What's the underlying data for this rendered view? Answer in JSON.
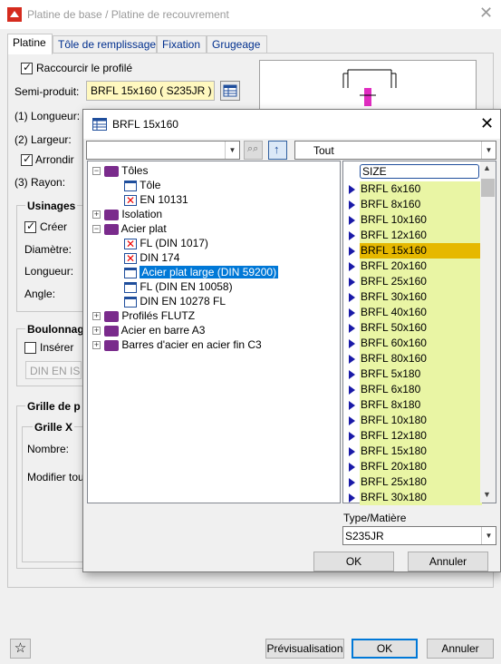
{
  "window": {
    "title": "Platine de base / Platine de recouvrement"
  },
  "tabs": [
    "Platine",
    "Tôle de remplissage",
    "Fixation",
    "Grugeage"
  ],
  "platine": {
    "raccourcir_label": "Raccourcir le profilé",
    "semi_produit_label": "Semi-produit:",
    "semi_produit_value": "BRFL 15x160  ( S235JR )",
    "longueur_label": "(1) Longueur:",
    "largeur_label": "(2) Largeur:",
    "arrondir_label": "Arrondir",
    "rayon_label": "(3) Rayon:",
    "usinages_title": "Usinages",
    "creer_label": "Créer",
    "diametre_label": "Diamètre:",
    "longueur2_label": "Longueur:",
    "angle_label": "Angle:",
    "boulonnage_title": "Boulonnag",
    "inserer_label": "Insérer",
    "din_button": "DIN EN ISO",
    "grille_title": "Grille de p",
    "grille_x_title": "Grille X",
    "nombre_label": "Nombre:",
    "modifier_label": "Modifier tou"
  },
  "footer": {
    "preview": "Prévisualisation",
    "ok": "OK",
    "cancel": "Annuler"
  },
  "dialog": {
    "title": "BRFL 15x160",
    "filter_value": "Tout",
    "tree": [
      {
        "label": "Tôles"
      },
      {
        "label": "Tôle"
      },
      {
        "label": "EN 10131"
      },
      {
        "label": "Isolation"
      },
      {
        "label": "Acier plat"
      },
      {
        "label": "FL (DIN 1017)"
      },
      {
        "label": "DIN 174"
      },
      {
        "label": "Acier plat large (DIN 59200)"
      },
      {
        "label": "FL (DIN EN 10058)"
      },
      {
        "label": "DIN EN 10278 FL"
      },
      {
        "label": "Profilés FLUTZ"
      },
      {
        "label": "Acier en barre A3"
      },
      {
        "label": "Barres d'acier en acier fin C3"
      }
    ],
    "list_header": "SIZE",
    "list": [
      "BRFL 6x160",
      "BRFL 8x160",
      "BRFL 10x160",
      "BRFL 12x160",
      "BRFL 15x160",
      "BRFL 20x160",
      "BRFL 25x160",
      "BRFL 30x160",
      "BRFL 40x160",
      "BRFL 50x160",
      "BRFL 60x160",
      "BRFL 80x160",
      "BRFL 5x180",
      "BRFL 6x180",
      "BRFL 8x180",
      "BRFL 10x180",
      "BRFL 12x180",
      "BRFL 15x180",
      "BRFL 20x180",
      "BRFL 25x180",
      "BRFL 30x180"
    ],
    "selected_size": "BRFL 15x160",
    "type_label": "Type/Matière",
    "type_value": "S235JR",
    "ok": "OK",
    "cancel": "Annuler"
  },
  "colors": {
    "accent": "#0078d7",
    "list_bg": "#e9f5a4",
    "list_selected": "#e6b800",
    "yellow_field": "#fff8bf"
  }
}
